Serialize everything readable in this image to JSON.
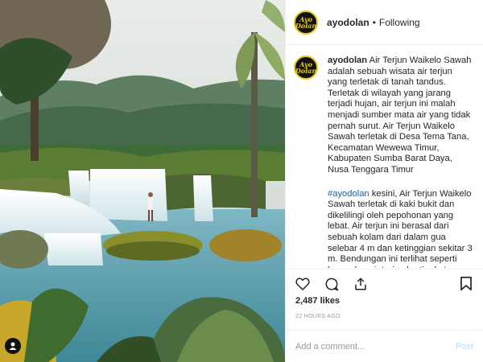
{
  "header": {
    "avatar_text": "Ayo Dolan",
    "username": "ayodolan",
    "separator": "•",
    "follow_status": "Following"
  },
  "caption": {
    "username": "ayodolan",
    "text": "Air Terjun Waikelo Sawah adalah sebuah wisata air terjun yang terletak di tanah tandus. Terletak di wilayah yang jarang terjadi hujan, air terjun ini malah menjadi sumber mata air yang tidak pernah surut. Air Terjun Waikelo Sawah terletak di Desa Tema Tana, Kecamatan Wewewa Timur, Kabupaten Sumba Barat Daya, Nusa Tenggara Timur",
    "hashtag": "#ayodolan",
    "text2": "kesini, Air Terjun Waikelo Sawah terletak di kaki bukit dan dikelilingi oleh pepohonan yang lebat. Air terjun ini berasal dari sebuah kolam dari dalam gua selebar 4 m dan ketinggian sekitar 3 m. Bendungan ini terlihat seperti kumpulan air terjun bertingkat"
  },
  "actions": {
    "like_icon": "heart-icon",
    "comment_icon": "comment-icon",
    "share_icon": "share-icon",
    "save_icon": "bookmark-icon"
  },
  "likes": "2,487 likes",
  "timestamp": "22 HOURS AGO",
  "comment_box": {
    "placeholder": "Add a comment...",
    "post_label": "Post"
  },
  "colors": {
    "link": "#1a5f9e",
    "post_disabled": "#b2dffc",
    "avatar_ring": "#e6c919"
  }
}
